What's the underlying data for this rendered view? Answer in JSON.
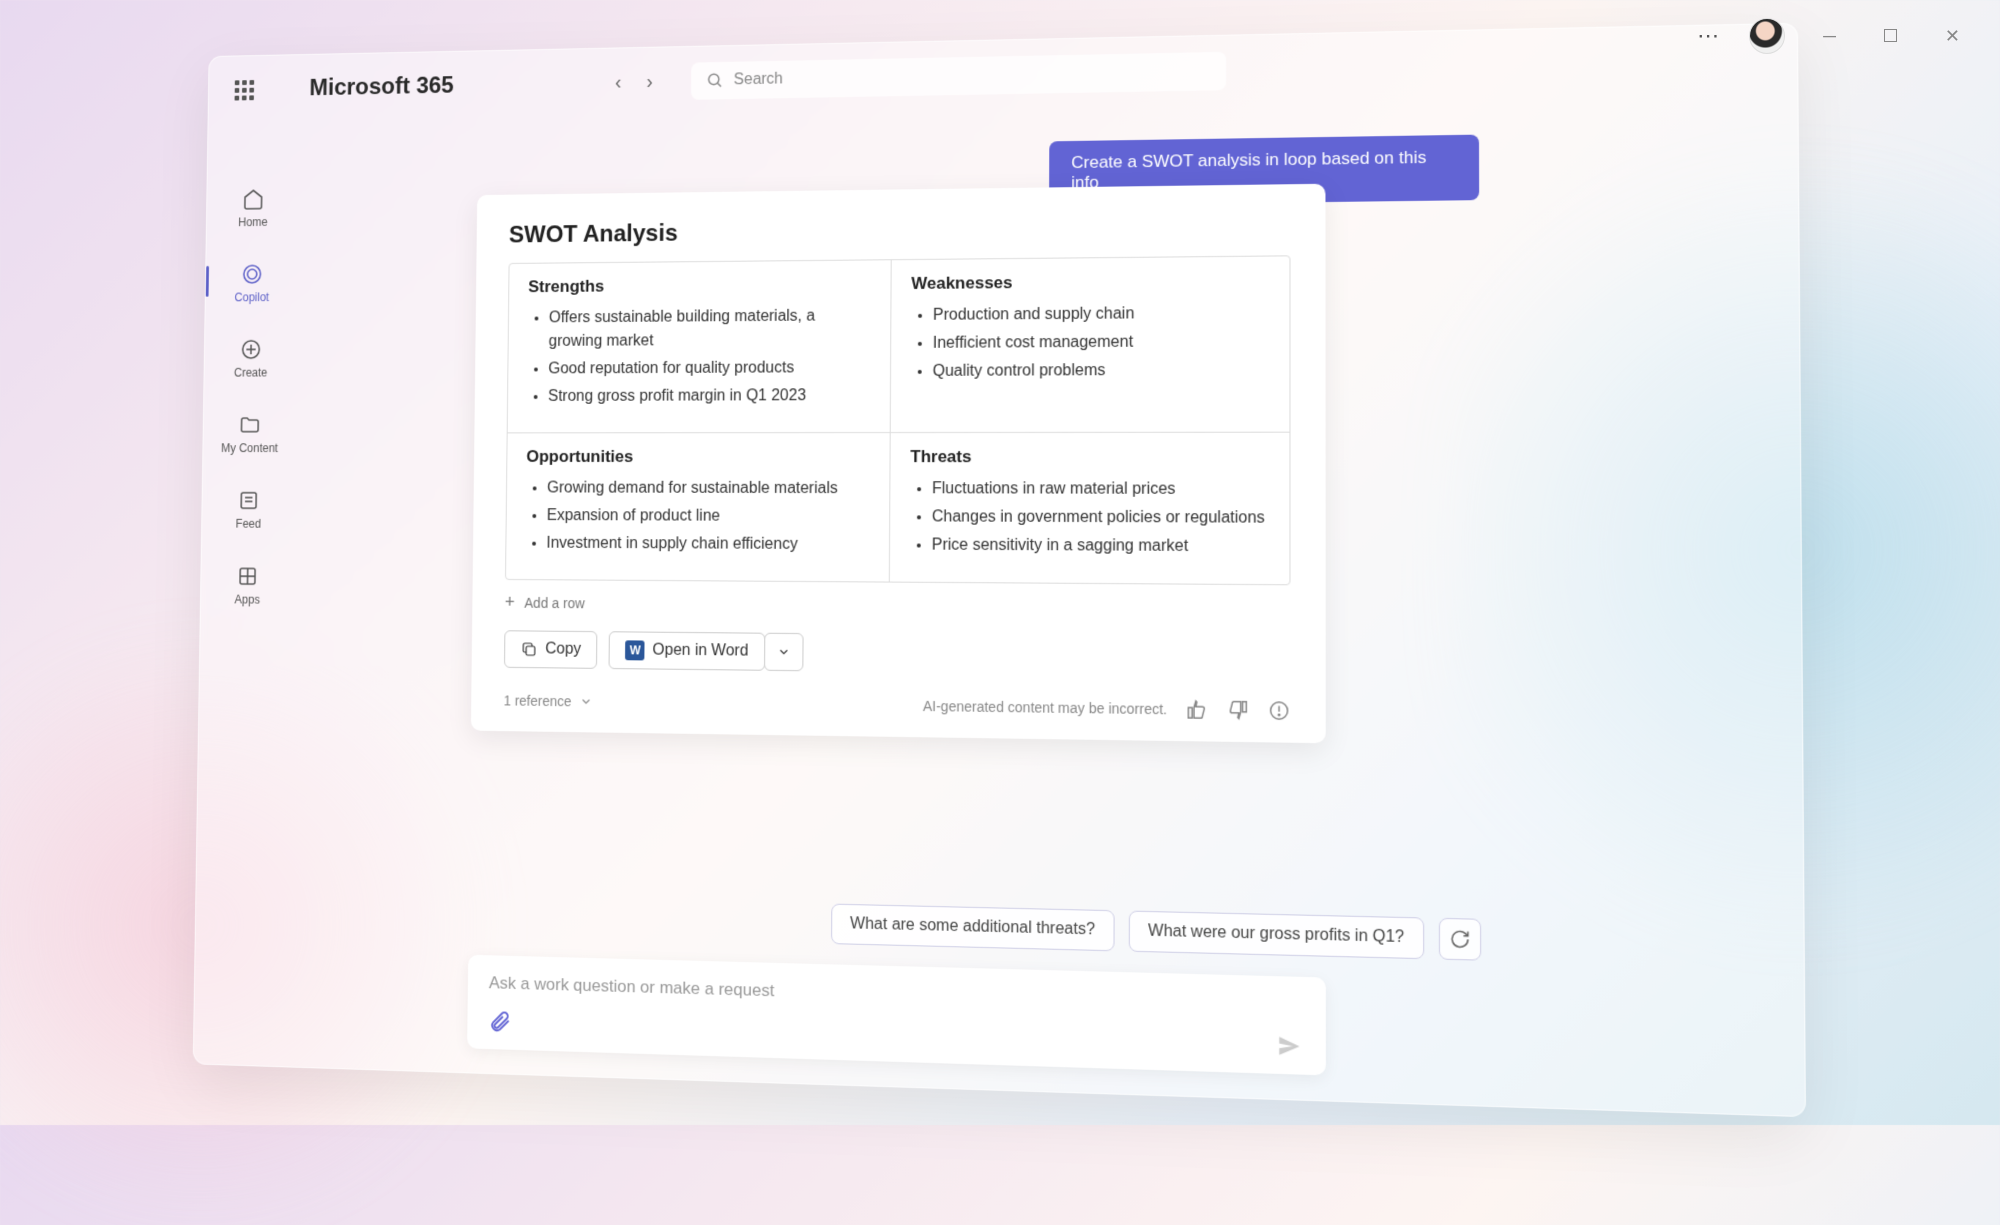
{
  "brand": "Microsoft 365",
  "search": {
    "placeholder": "Search"
  },
  "titlebar": {
    "more": "⋯"
  },
  "sidebar": {
    "items": [
      {
        "label": "Home"
      },
      {
        "label": "Copilot"
      },
      {
        "label": "Create"
      },
      {
        "label": "My Content"
      },
      {
        "label": "Feed"
      },
      {
        "label": "Apps"
      }
    ]
  },
  "chat": {
    "user_message": "Create a SWOT analysis in loop based on this info",
    "swot": {
      "title": "SWOT Analysis",
      "quadrants": [
        {
          "heading": "Strengths",
          "items": [
            "Offers sustainable building materials, a growing market",
            "Good reputation for quality products",
            "Strong gross profit margin in Q1 2023"
          ]
        },
        {
          "heading": "Weaknesses",
          "items": [
            "Production and supply chain",
            "Inefficient cost management",
            "Quality control problems"
          ]
        },
        {
          "heading": "Opportunities",
          "items": [
            "Growing demand for sustainable materials",
            "Expansion of product line",
            "Investment in supply chain efficiency"
          ]
        },
        {
          "heading": "Threats",
          "items": [
            "Fluctuations in raw material prices",
            "Changes in government policies or regulations",
            "Price sensitivity in a sagging market"
          ]
        }
      ],
      "add_row": "Add a row"
    },
    "actions": {
      "copy": "Copy",
      "open_word": "Open in Word"
    },
    "disclaimer": "AI-generated content may be incorrect.",
    "reference": "1 reference",
    "suggestions": [
      "What are some additional threats?",
      "What were our gross profits in Q1?"
    ],
    "input_placeholder": "Ask a work question or make a request"
  }
}
